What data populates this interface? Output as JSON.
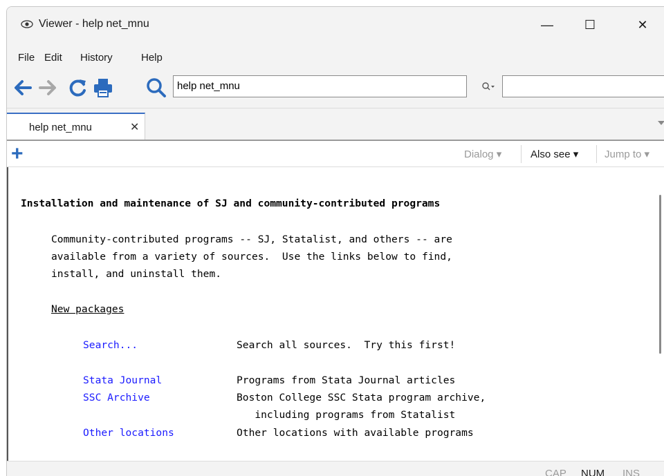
{
  "window": {
    "title": "Viewer - help net_mnu",
    "minimize_glyph": "—",
    "maximize_glyph": "☐",
    "close_glyph": "✕"
  },
  "menu": [
    "File",
    "Edit",
    "History",
    "Help"
  ],
  "toolbar": {
    "address_value": "help net_mnu",
    "icons": [
      "back-arrow-icon",
      "forward-arrow-icon",
      "refresh-icon",
      "print-icon",
      "search-icon"
    ]
  },
  "tab": {
    "label": "help net_mnu",
    "close_glyph": "✕"
  },
  "helpbar": {
    "plus_glyph": "+",
    "dialog_label": "Dialog ▾",
    "also_see_label": "Also see ▾",
    "jump_to_label": "Jump to ▾"
  },
  "doc": {
    "heading": "Installation and maintenance of SJ and community-contributed programs",
    "intro": [
      "Community-contributed programs -- SJ, Statalist, and others -- are",
      "available from a variety of sources.  Use the links below to find,",
      "install, and uninstall them."
    ],
    "section": "New packages",
    "links": [
      {
        "label": "Search...",
        "desc": "Search all sources.  Try this first!"
      },
      {
        "label": "Stata Journal",
        "desc": "Programs from Stata Journal articles"
      },
      {
        "label": "SSC Archive",
        "desc": "Boston College SSC Stata program archive,"
      },
      {
        "label": "",
        "desc": "   including programs from Statalist"
      },
      {
        "label": "Other locations",
        "desc": "Other locations with available programs"
      }
    ]
  },
  "status": {
    "cap": "CAP",
    "num": "NUM",
    "ins": "INS"
  },
  "colors": {
    "link": "#1a1aff",
    "accent": "#2c6bbd",
    "inactive": "#9a9a9a"
  }
}
